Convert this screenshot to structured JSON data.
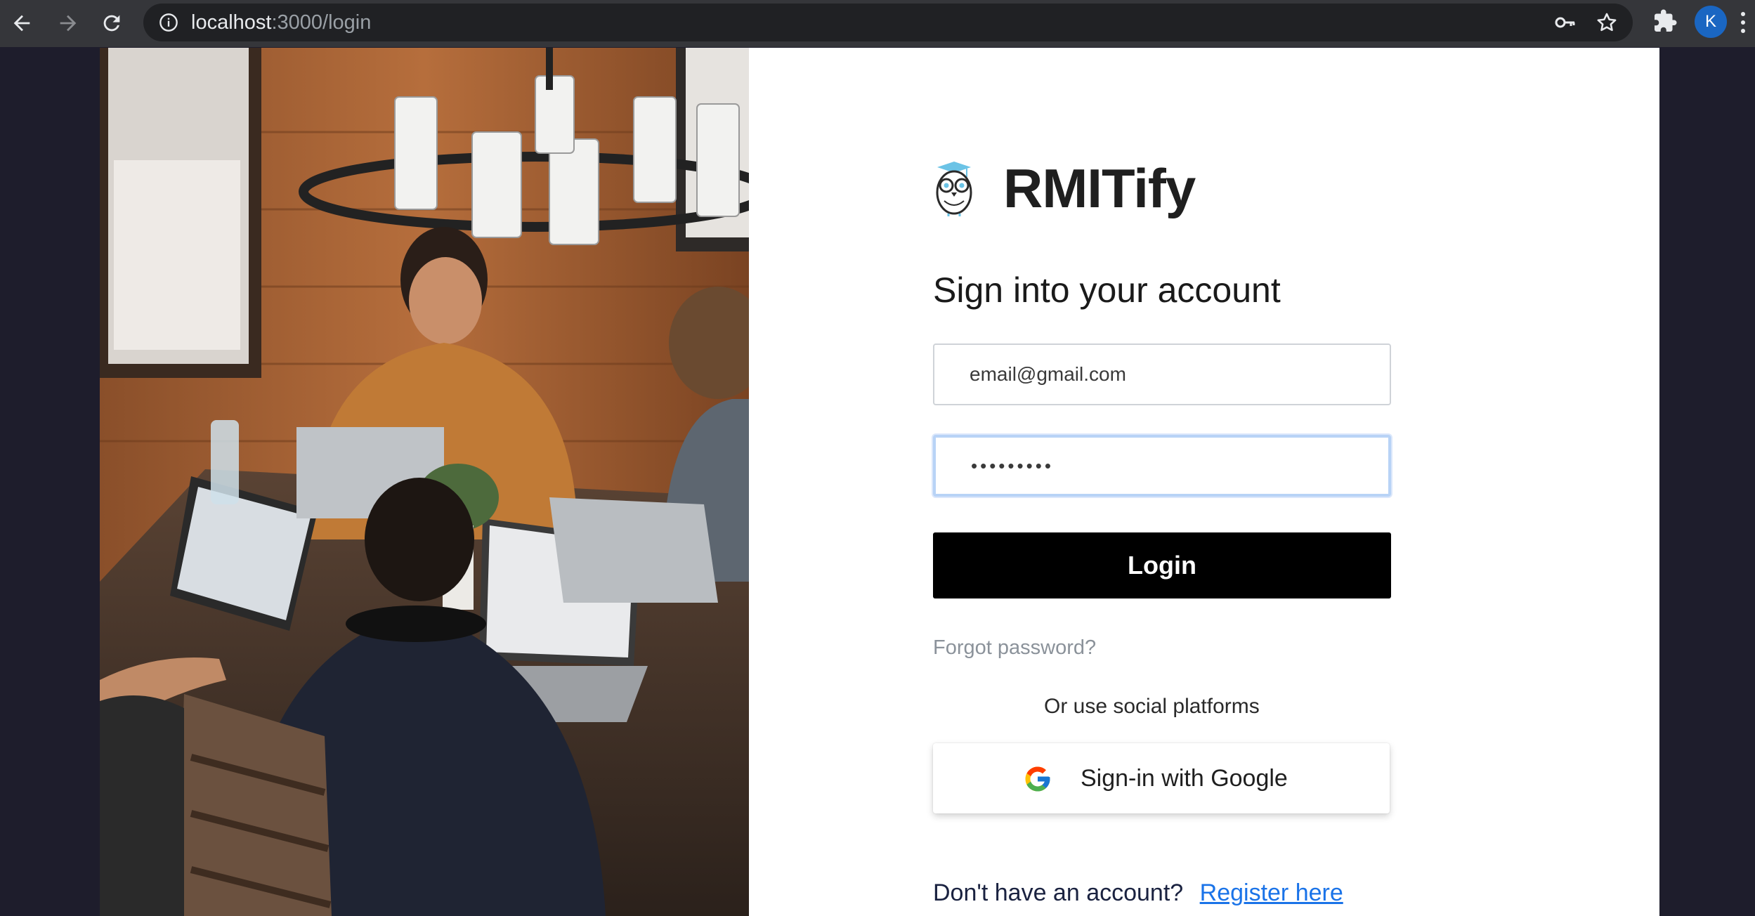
{
  "browser": {
    "url_host": "localhost",
    "url_path": ":3000/login",
    "profile_initial": "K"
  },
  "brand": {
    "name": "RMITify"
  },
  "form": {
    "heading": "Sign into your account",
    "email_value": "email@gmail.com",
    "password_value": "•••••••••",
    "login_label": "Login",
    "forgot_label": "Forgot password?",
    "social_label": "Or use social platforms",
    "google_label": "Sign-in with Google",
    "register_prompt": "Don't have an account?",
    "register_link": "Register here"
  },
  "colors": {
    "link": "#1a73e8",
    "login_button": "#000000",
    "avatar": "#1a66c2"
  }
}
